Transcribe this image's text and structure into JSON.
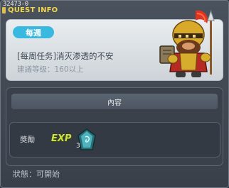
{
  "window": {
    "quest_id": "32473-0",
    "title": "QUEST INFO"
  },
  "header": {
    "type_badge": "每週",
    "quest_name": "[每周任务]消灭渗透的不安",
    "level_requirement": "建議等级：160以上",
    "npc_icon": "knight-npc-portrait"
  },
  "content": {
    "section_title": "內容",
    "reward_label": "獎勵",
    "exp_label": "EXP",
    "reward_item_icon": "crystal-gem-icon",
    "reward_item_count": "3"
  },
  "footer": {
    "status": "狀態：可開始"
  },
  "colors": {
    "title_text": "#f2d64a",
    "badge_bg": "#3ab9e0",
    "exp_text": "#cfe23a"
  }
}
